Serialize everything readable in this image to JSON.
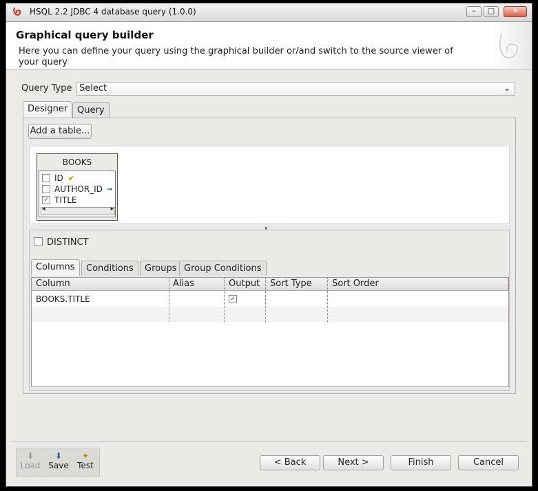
{
  "window": {
    "title": "HSQL 2.2 JDBC 4 database query (1.0.0)",
    "controls": {
      "minimize": "–",
      "maximize": "□",
      "close": "✕"
    }
  },
  "header": {
    "title": "Graphical query builder",
    "description": "Here you can define your query using the graphical builder or/and switch to the source viewer of your query"
  },
  "query_type": {
    "label": "Query Type",
    "value": "Select",
    "arrow": "⌄"
  },
  "main_tabs": [
    {
      "label": "Designer"
    },
    {
      "label": "Query"
    }
  ],
  "designer": {
    "add_table_button": "Add a table...",
    "table": {
      "name": "BOOKS",
      "fields": [
        {
          "label": "ID",
          "checked": false,
          "mark": ""
        },
        {
          "label": "AUTHOR_ID",
          "checked": false,
          "mark": ""
        },
        {
          "label": "TITLE",
          "checked": true,
          "mark": "✓"
        }
      ],
      "scroll_left": "◂",
      "scroll_right": "▸"
    },
    "splitter_arrow": "▾",
    "distinct_label": "DISTINCT",
    "sub_tabs": [
      {
        "label": "Columns"
      },
      {
        "label": "Conditions"
      },
      {
        "label": "Groups"
      },
      {
        "label": "Group Conditions"
      }
    ],
    "grid": {
      "headers": [
        "Column",
        "Alias",
        "Output",
        "Sort Type",
        "Sort Order"
      ],
      "rows": [
        {
          "column": "BOOKS.TITLE",
          "alias": "",
          "output_mark": "✓",
          "sort_type": "",
          "sort_order": ""
        }
      ]
    }
  },
  "tools": [
    {
      "label": "Load",
      "icon": "load-icon",
      "enabled": false,
      "glyph": "⬇"
    },
    {
      "label": "Save",
      "icon": "save-icon",
      "enabled": true,
      "glyph": "⬇"
    },
    {
      "label": "Test",
      "icon": "test-icon",
      "enabled": true,
      "glyph": "✦"
    }
  ],
  "buttons": {
    "back": "< Back",
    "next": "Next >",
    "finish": "Finish",
    "cancel": "Cancel"
  },
  "colors": {
    "accent": "#c0392b",
    "window_bg": "#eceae6"
  }
}
